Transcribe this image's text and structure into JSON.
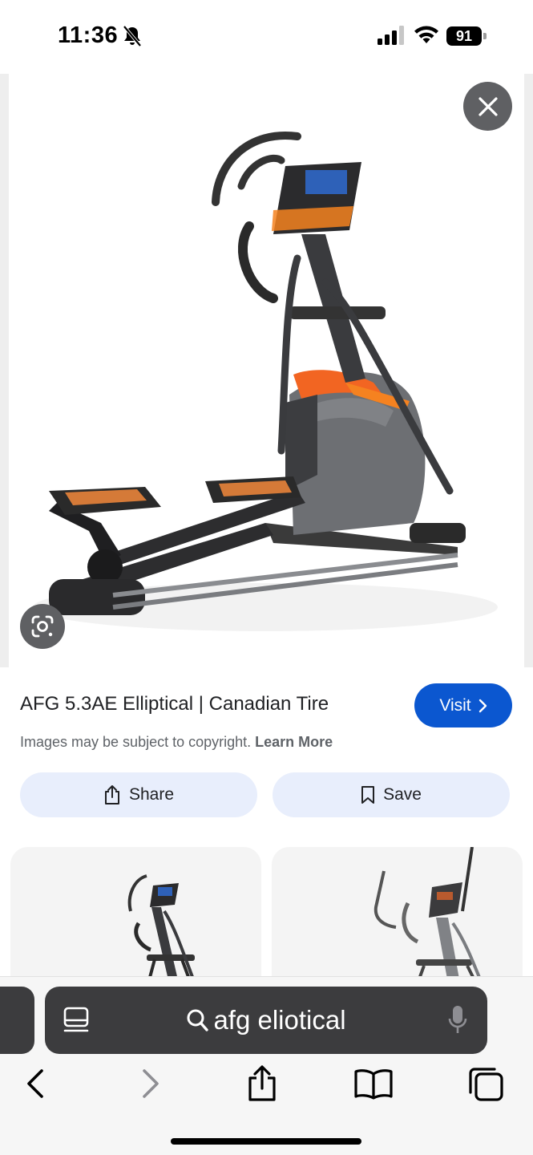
{
  "status_bar": {
    "time": "11:36",
    "battery": "91",
    "silent_icon": "bell-slash-icon",
    "signal_icon": "cellular-signal-icon",
    "wifi_icon": "wifi-icon"
  },
  "image_viewer": {
    "close_icon": "close-icon",
    "lens_icon": "google-lens-icon",
    "title": "AFG 5.3AE Elliptical | Canadian Tire",
    "visit_label": "Visit",
    "copyright_text": "Images may be subject to copyright.",
    "learn_more": "Learn More",
    "share_label": "Share",
    "save_label": "Save"
  },
  "related": {
    "cards": [
      {
        "thumbnail": "elliptical-thumbnail-1"
      },
      {
        "thumbnail": "elliptical-thumbnail-2"
      }
    ]
  },
  "browser": {
    "search_query": "afg eliotical",
    "accent": "#0b57d0",
    "toolbar": [
      "back-icon",
      "forward-icon",
      "share-icon",
      "bookmarks-icon",
      "tabs-icon"
    ]
  }
}
